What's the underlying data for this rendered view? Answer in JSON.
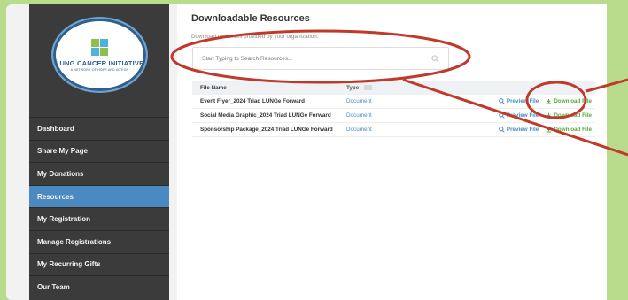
{
  "sidebar": {
    "logo": {
      "title": "LUNG CANCER INITIATIVE",
      "subtitle": "A NETWORK OF HOPE AND ACTION"
    },
    "items": [
      {
        "label": "Dashboard",
        "active": false
      },
      {
        "label": "Share My Page",
        "active": false
      },
      {
        "label": "My Donations",
        "active": false
      },
      {
        "label": "Resources",
        "active": true
      },
      {
        "label": "My Registration",
        "active": false
      },
      {
        "label": "Manage Registrations",
        "active": false
      },
      {
        "label": "My Recurring Gifts",
        "active": false
      },
      {
        "label": "Our Team",
        "active": false
      }
    ],
    "active_color": "#4a8ac0"
  },
  "main": {
    "title": "Downloadable Resources",
    "subtitle": "Download resources provided by your organization.",
    "search": {
      "placeholder": "Start Typing to Search Resources...",
      "value": ""
    },
    "table": {
      "columns": [
        "File Name",
        "Type"
      ],
      "rows": [
        {
          "name": "Event Flyer_2024 Triad LUNGe Forward",
          "type": "Document",
          "preview": "Preview File",
          "download": "Download File"
        },
        {
          "name": "Social Media Graphic_2024 Triad LUNGe Forward",
          "type": "Document",
          "preview": "Preview File",
          "download": "Download File"
        },
        {
          "name": "Sponsorship Package_2024 Triad LUNGe Forward",
          "type": "Document",
          "preview": "Preview File",
          "download": "Download File"
        }
      ]
    }
  },
  "annotations": {
    "color": "#c0392b"
  }
}
